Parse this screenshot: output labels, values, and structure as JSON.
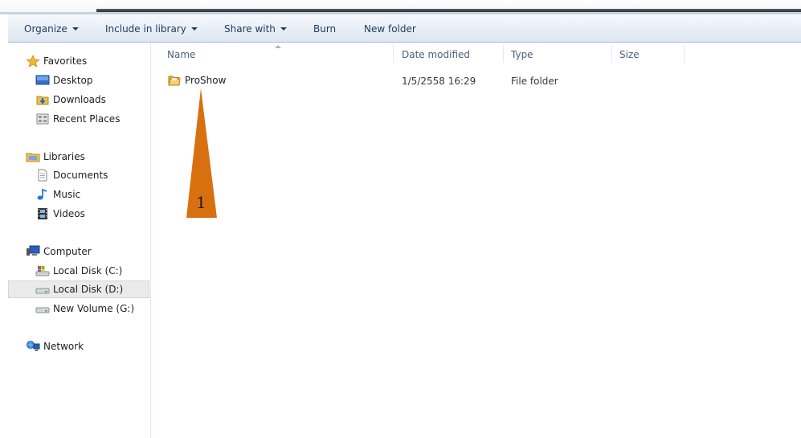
{
  "toolbar": {
    "organize": "Organize",
    "include_in_library": "Include in library",
    "share_with": "Share with",
    "burn": "Burn",
    "new_folder": "New folder"
  },
  "nav": {
    "favorites": "Favorites",
    "desktop": "Desktop",
    "downloads": "Downloads",
    "recent_places": "Recent Places",
    "libraries": "Libraries",
    "documents": "Documents",
    "music": "Music",
    "videos": "Videos",
    "computer": "Computer",
    "local_disk_c": "Local Disk (C:)",
    "local_disk_d": "Local Disk (D:)",
    "new_volume_g": "New Volume (G:)",
    "network": "Network",
    "selected": "local_disk_d"
  },
  "columns": {
    "name": "Name",
    "date_modified": "Date modified",
    "type": "Type",
    "size": "Size"
  },
  "files": [
    {
      "name": "ProShow",
      "date_modified": "1/5/2558 16:29",
      "type": "File folder",
      "size": ""
    }
  ],
  "annotation": {
    "label": "1",
    "color": "#d9700f"
  },
  "icons": {
    "favorites": "star-icon",
    "desktop": "desktop-icon",
    "downloads": "downloads-icon",
    "recent_places": "recent-places-icon",
    "libraries": "libraries-icon",
    "documents": "document-icon",
    "music": "music-icon",
    "videos": "video-icon",
    "computer": "computer-icon",
    "drive_c": "system-drive-icon",
    "drive_d": "drive-icon",
    "drive_g": "drive-icon",
    "network": "network-icon",
    "folder": "folder-icon"
  }
}
